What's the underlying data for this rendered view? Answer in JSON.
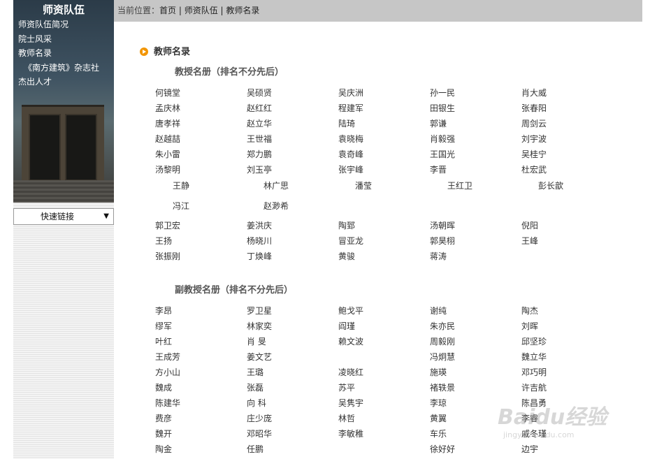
{
  "sidebar": {
    "title": "师资队伍",
    "items": [
      "师资队伍简况",
      "院士风采",
      "教师名录",
      "《南方建筑》杂志社",
      "杰出人才"
    ],
    "quick_links": "快速链接"
  },
  "breadcrumb": {
    "label": "当前位置：",
    "path": "首页 | 师资队伍 | 教师名录"
  },
  "section_title": "教师名录",
  "professors": {
    "heading": "教授名册（排名不分先后）",
    "rows_a": [
      [
        "何镜堂",
        "吴硕贤",
        "吴庆洲",
        "孙一民",
        "肖大威"
      ],
      [
        "孟庆林",
        "赵红红",
        "程建军",
        "田银生",
        "张春阳"
      ],
      [
        "唐孝祥",
        "赵立华",
        "陆琦",
        "郭谦",
        "周剑云"
      ],
      [
        "赵越喆",
        "王世福",
        "袁晓梅",
        "肖毅强",
        "刘宇波"
      ],
      [
        "朱小雷",
        "郑力鹏",
        "袁奇峰",
        "王国光",
        "吴桂宁"
      ],
      [
        "汤黎明",
        "刘玉亭",
        "张宇峰",
        "李晋",
        "杜宏武"
      ]
    ],
    "rows_b": [
      [
        "王静",
        "林广思",
        "潘莹",
        "王红卫",
        "彭长歆"
      ],
      [
        "冯江",
        "赵渺希"
      ]
    ],
    "rows_c": [
      [
        "郭卫宏",
        "姜洪庆",
        "陶郅",
        "汤朝晖",
        "倪阳"
      ],
      [
        "王扬",
        "杨晓川",
        "冒亚龙",
        "郭昊栩",
        "王峰"
      ],
      [
        "张振刚",
        "丁焕峰",
        "黄骏",
        "蒋涛"
      ]
    ]
  },
  "associate_professors": {
    "heading": "副教授名册（排名不分先后）",
    "rows": [
      [
        "李昂",
        "罗卫星",
        "鲍戈平",
        "谢纯",
        "陶杰"
      ],
      [
        "缪军",
        "林家奕",
        "阎瑾",
        "朱亦民",
        "刘晖"
      ],
      [
        "叶红",
        "肖 旻",
        "赖文波",
        "周毅刚",
        "邱坚珍"
      ],
      [
        "王成芳",
        "姜文艺",
        "",
        "冯炯慧",
        "魏立华"
      ],
      [
        "方小山",
        "王璐",
        "凌晓红",
        "施瑛",
        "邓巧明"
      ],
      [
        "魏成",
        "张磊",
        "苏平",
        "褚轶景",
        "许吉航"
      ],
      [
        "陈建华",
        "向 科",
        "吴隽宇",
        "李琼",
        "陈昌勇"
      ],
      [
        "费彦",
        "庄少庞",
        "林哲",
        "黄翼",
        "李睿"
      ],
      [
        "魏开",
        "邓昭华",
        "李敏稚",
        "车乐",
        "戚冬瑾"
      ],
      [
        "陶金",
        "任鹏",
        "",
        "徐好好",
        "边宇"
      ]
    ]
  },
  "watermark": {
    "main": "Baidu经验",
    "sub": "jingyan.baidu.com"
  }
}
